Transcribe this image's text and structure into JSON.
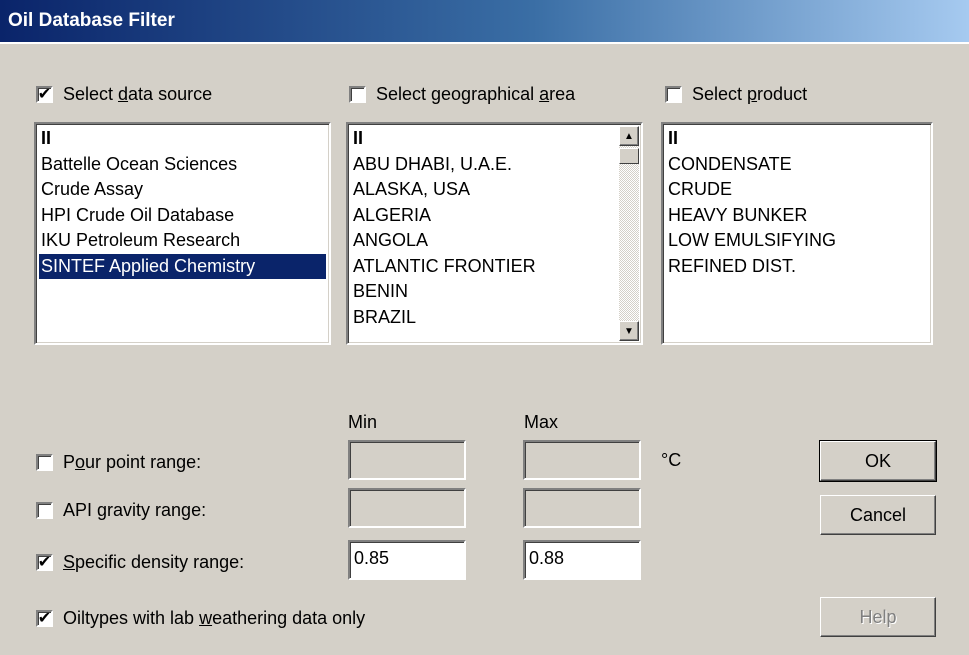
{
  "window": {
    "title": "Oil Database Filter"
  },
  "selectors": {
    "data_source": {
      "pre": "Select ",
      "accel": "d",
      "post": "ata source",
      "checked": true
    },
    "geo_area": {
      "pre": "Select geographical ",
      "accel": "a",
      "post": "rea",
      "checked": false
    },
    "product": {
      "pre": "Select ",
      "accel": "p",
      "post": "roduct",
      "checked": false
    }
  },
  "lists": {
    "data_source": [
      "II",
      "Battelle Ocean Sciences",
      "Crude Assay",
      "HPI Crude Oil Database",
      "IKU Petroleum Research",
      "SINTEF Applied Chemistry"
    ],
    "data_source_selected": "SINTEF Applied Chemistry",
    "geo_area": [
      "II",
      "ABU DHABI, U.A.E.",
      "ALASKA, USA",
      "ALGERIA",
      "ANGOLA",
      "ATLANTIC FRONTIER",
      "BENIN",
      "BRAZIL"
    ],
    "product": [
      "II",
      "CONDENSATE",
      "CRUDE",
      "HEAVY BUNKER",
      "LOW EMULSIFYING",
      "REFINED DIST."
    ]
  },
  "ranges": {
    "min_header": "Min",
    "max_header": "Max",
    "pour_point": {
      "pre": "P",
      "accel": "o",
      "post": "ur point range:",
      "checked": false,
      "min": "",
      "max": "",
      "unit": "°C"
    },
    "api_gravity": {
      "pre": "API ",
      "accel": "g",
      "post": "ravity range:",
      "checked": false,
      "min": "",
      "max": ""
    },
    "specific_density": {
      "pre": "",
      "accel": "S",
      "post": "pecific density range:",
      "checked": true,
      "min": "0.85",
      "max": "0.88"
    }
  },
  "weathering": {
    "pre": "Oiltypes with lab ",
    "accel": "w",
    "post": "eathering data only",
    "checked": true
  },
  "buttons": {
    "ok": "OK",
    "cancel": "Cancel",
    "help": "Help"
  },
  "icons": {
    "check": "✔",
    "scroll_up": "▲",
    "scroll_down": "▼"
  }
}
